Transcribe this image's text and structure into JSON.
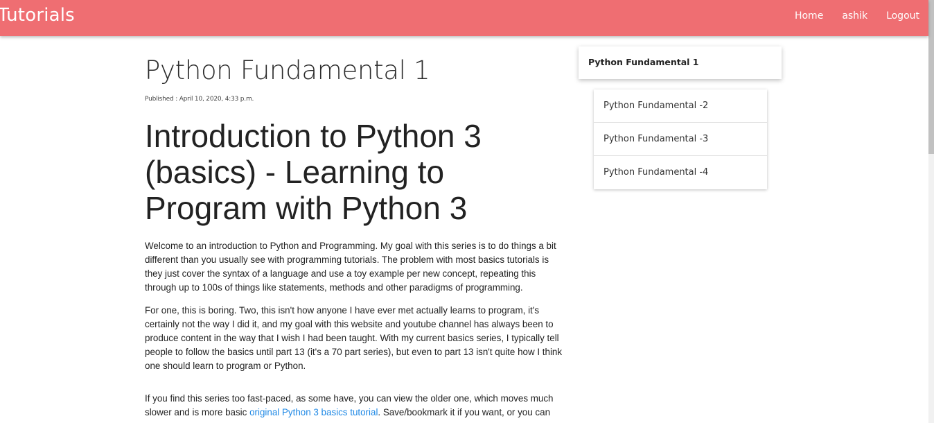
{
  "navbar": {
    "brand": "Tutorials",
    "links": [
      "Home",
      "ashik",
      "Logout"
    ],
    "background": "#ef6e72"
  },
  "article": {
    "title": "Python Fundamental 1",
    "published_label": "Published : ",
    "published_date": "April 10, 2020, 4:33 p.m.",
    "heading": "Introduction to Python 3 (basics) - Learning to Program with Python 3",
    "paragraph1": "Welcome to an introduction to Python and Programming. My goal with this series is to do things a bit different than you usually see with programming tutorials. The problem with most basics tutorials is they just cover the syntax of a language and use a toy example per new concept, repeating this through up to 100s of things like statements, methods and other paradigms of programming.",
    "paragraph2": "For one, this is boring. Two, this isn't how anyone I have ever met actually learns to program, it's certainly not the way I did it, and my goal with this website and youtube channel has always been to produce content in the way that I wish I had been taught. With my current basics series, I typically tell people to follow the basics until part 13 (it's a 70 part series), but even to part 13 isn't quite how I think one should learn to program or Python.",
    "paragraph3_before": "If you find this series too fast-paced, as some have, you can view the older one, which moves much slower and is more basic ",
    "paragraph3_link": "original Python 3 basics tutorial",
    "paragraph3_after": ". Save/bookmark it if you want, or you can",
    "link_color": "#1e88e5"
  },
  "sidebar": {
    "current": "Python Fundamental 1",
    "items": [
      "Python Fundamental -2",
      "Python Fundamental -3",
      "Python Fundamental -4"
    ]
  }
}
